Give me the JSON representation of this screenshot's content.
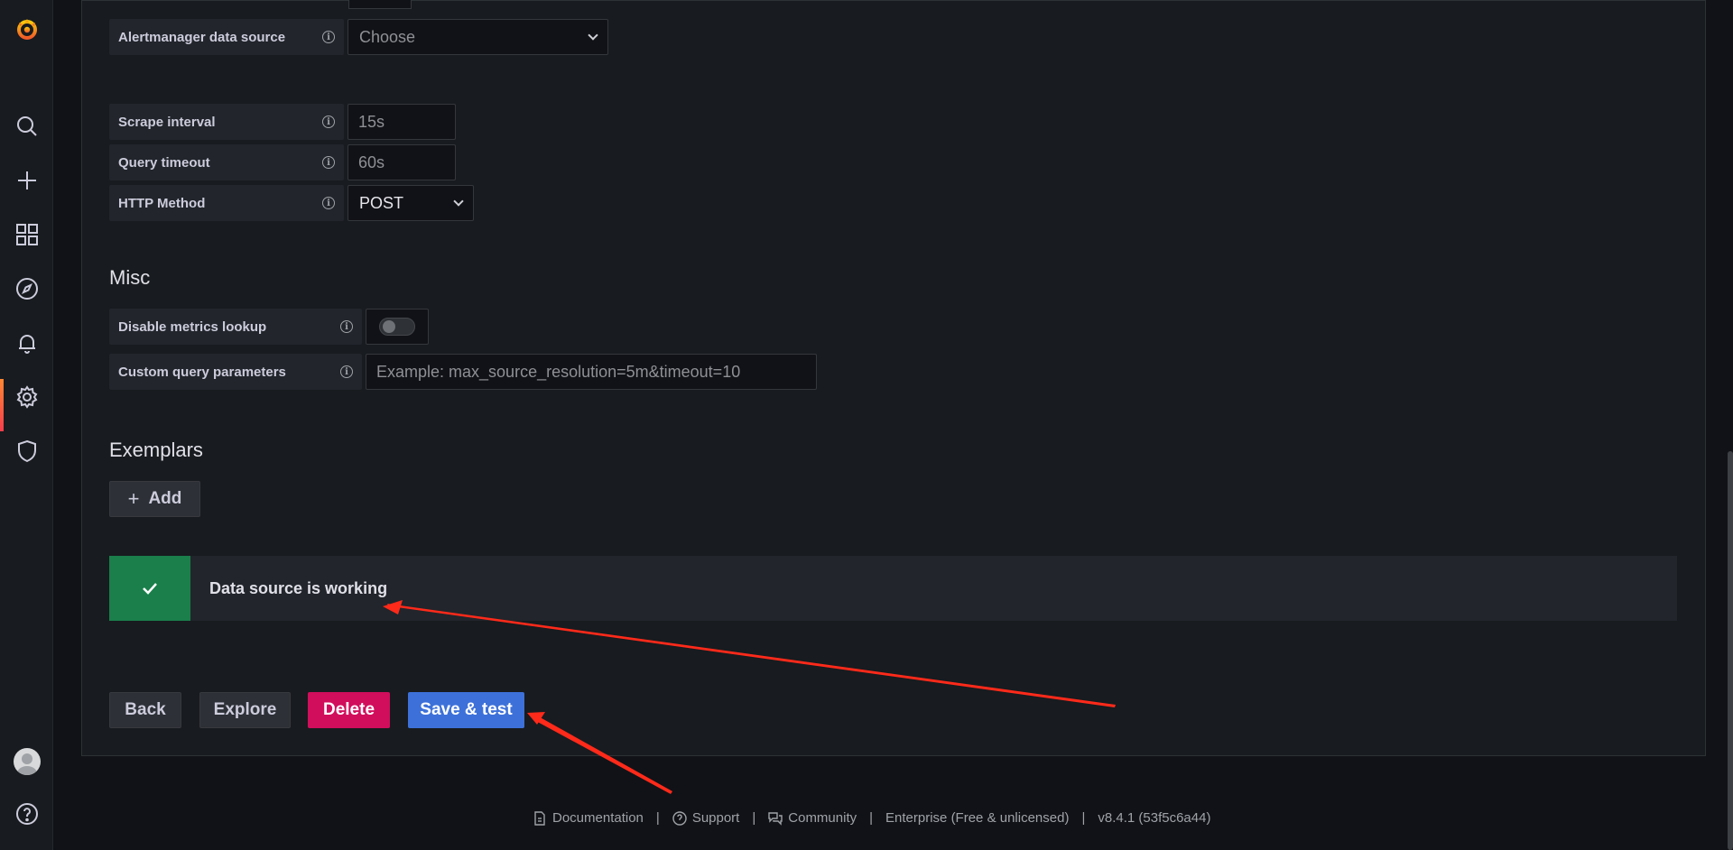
{
  "sidebar": {
    "items": [
      {
        "icon": "grafana-logo-icon"
      },
      {
        "icon": "search-icon"
      },
      {
        "icon": "plus-icon"
      },
      {
        "icon": "dashboards-icon"
      },
      {
        "icon": "explore-compass-icon"
      },
      {
        "icon": "alerting-bell-icon"
      },
      {
        "icon": "configuration-gear-icon",
        "active": true
      },
      {
        "icon": "server-admin-shield-icon"
      },
      {
        "icon": "user-avatar"
      },
      {
        "icon": "help-icon"
      }
    ]
  },
  "fields": {
    "alertmanager": {
      "label": "Alertmanager data source",
      "placeholder": "Choose"
    },
    "scrape_interval": {
      "label": "Scrape interval",
      "placeholder": "15s"
    },
    "query_timeout": {
      "label": "Query timeout",
      "placeholder": "60s"
    },
    "http_method": {
      "label": "HTTP Method",
      "value": "POST"
    }
  },
  "misc": {
    "title": "Misc",
    "disable_metrics_lookup": {
      "label": "Disable metrics lookup",
      "enabled": false
    },
    "custom_query_params": {
      "label": "Custom query parameters",
      "placeholder": "Example: max_source_resolution=5m&timeout=10"
    }
  },
  "exemplars": {
    "title": "Exemplars",
    "add_label": "Add"
  },
  "alert": {
    "status": "success",
    "message": "Data source is working"
  },
  "actions": {
    "back": "Back",
    "explore": "Explore",
    "delete": "Delete",
    "save_test": "Save & test"
  },
  "footer": {
    "documentation": "Documentation",
    "support": "Support",
    "community": "Community",
    "edition": "Enterprise (Free & unlicensed)",
    "version": "v8.4.1 (53f5c6a44)"
  },
  "colors": {
    "accent_orange": "#ff8833",
    "success_green": "#1a7f4b",
    "danger": "#d10e5c",
    "primary": "#3d71d9",
    "annotation_arrow": "#ff2a1a"
  }
}
